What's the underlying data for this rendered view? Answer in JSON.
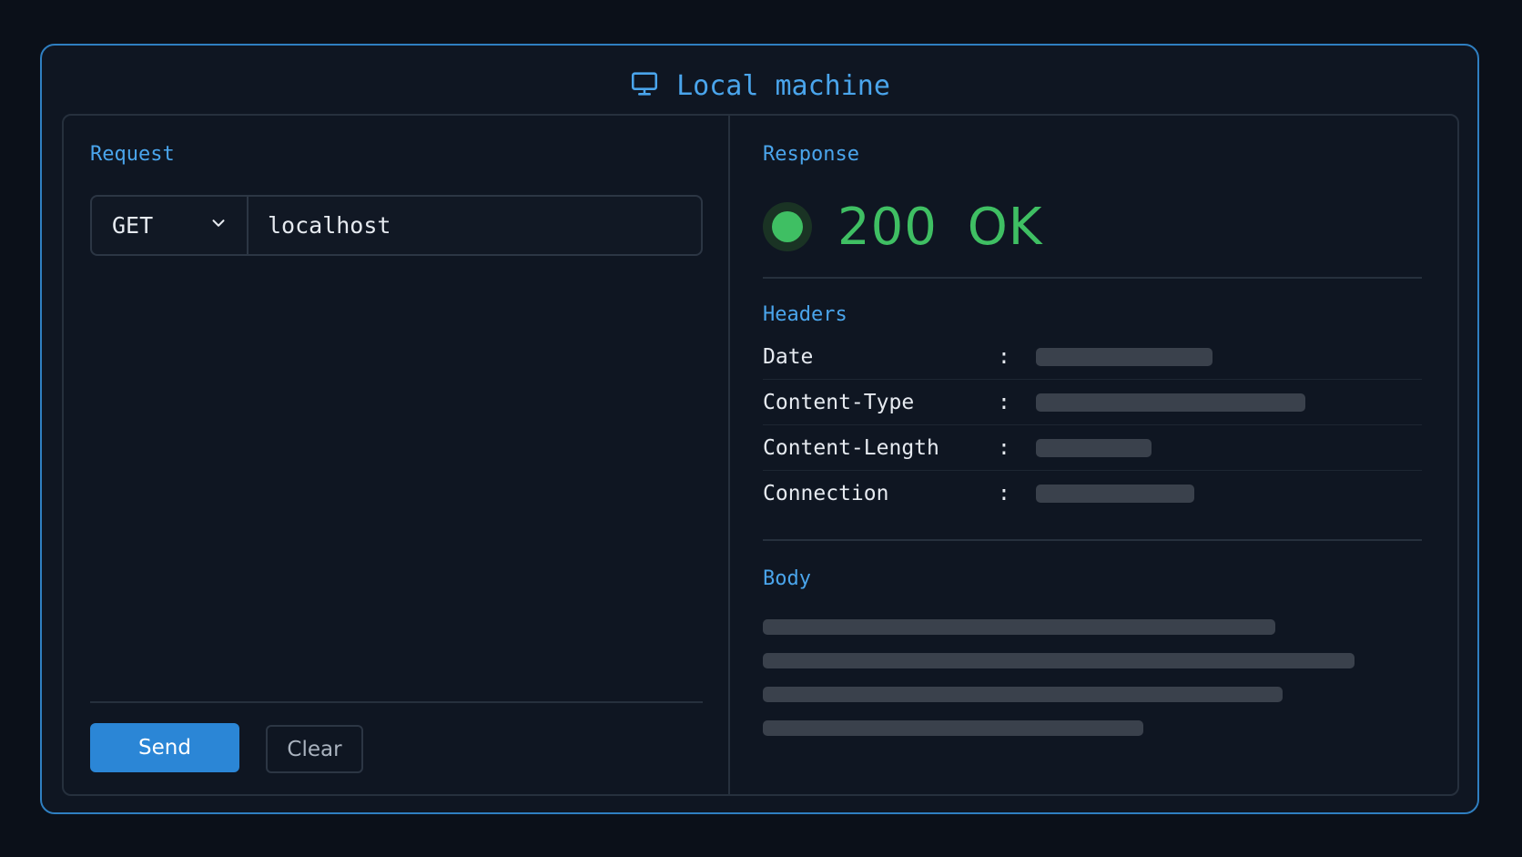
{
  "window": {
    "title": "Local machine",
    "icon": "monitor-icon",
    "accent_color": "#4aa5ec"
  },
  "request": {
    "section_label": "Request",
    "method": "GET",
    "url": "localhost",
    "send_label": "Send",
    "clear_label": "Clear"
  },
  "response": {
    "section_label": "Response",
    "status_text": "200 OK",
    "status_color": "#3fbf63",
    "headers_label": "Headers",
    "headers": [
      {
        "key": "Date",
        "separator": ":"
      },
      {
        "key": "Content-Type",
        "separator": ":"
      },
      {
        "key": "Content-Length",
        "separator": ":"
      },
      {
        "key": "Connection",
        "separator": ":"
      }
    ],
    "body_label": "Body"
  }
}
